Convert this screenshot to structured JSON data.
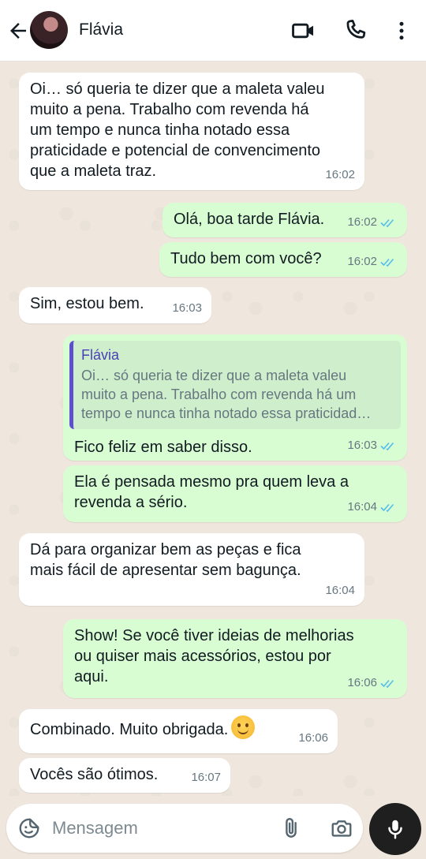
{
  "header": {
    "contact_name": "Flávia",
    "icons": [
      "back-arrow-icon",
      "avatar",
      "video-call-icon",
      "phone-icon",
      "more-vert-icon"
    ]
  },
  "messages": [
    {
      "dir": "in",
      "text": "Oi… só queria te dizer que a maleta valeu\nmuito a pena. Trabalho com revenda há\num tempo e nunca tinha notado essa\npraticidade e potencial de convencimento\nque a maleta traz.",
      "time": "16:02"
    },
    {
      "dir": "out",
      "text": "Olá, boa tarde Flávia.",
      "time": "16:02",
      "status": "read"
    },
    {
      "dir": "out",
      "text": "Tudo bem com você?",
      "time": "16:02",
      "status": "read"
    },
    {
      "dir": "in",
      "text": "Sim, estou bem.",
      "time": "16:03"
    },
    {
      "dir": "out",
      "quote_name": "Flávia",
      "quote_text": "Oi… só queria te dizer que a maleta valeu\nmuito a pena. Trabalho com revenda há um\ntempo e nunca tinha notado essa praticidad…",
      "text": "Fico feliz em saber disso.",
      "time": "16:03",
      "status": "read"
    },
    {
      "dir": "out",
      "text": "Ela é pensada mesmo pra quem leva a\nrevenda a sério.",
      "time": "16:04",
      "status": "read"
    },
    {
      "dir": "in",
      "text": "Dá para organizar bem as peças e fica\nmais fácil de apresentar sem bagunça.",
      "time": "16:04"
    },
    {
      "dir": "out",
      "text": "Show! Se você tiver ideias de melhorias\nou quiser mais acessórios, estou por\naqui.",
      "time": "16:06",
      "status": "read"
    },
    {
      "dir": "in",
      "text": "Combinado. Muito obrigada.",
      "emoji": "smiling-face-emoji",
      "time": "16:06"
    },
    {
      "dir": "in",
      "text": "Vocês são ótimos.",
      "time": "16:07"
    }
  ],
  "composer": {
    "placeholder": "Mensagem",
    "icons": [
      "sticker-icon",
      "attach-icon",
      "camera-icon",
      "mic-icon"
    ]
  },
  "colors": {
    "outgoing_bubble": "#d9fdd3",
    "incoming_bubble": "#ffffff",
    "chat_background": "#efe7dd",
    "read_ticks": "#53bdeb",
    "quote_bar": "#5e4fd1"
  }
}
